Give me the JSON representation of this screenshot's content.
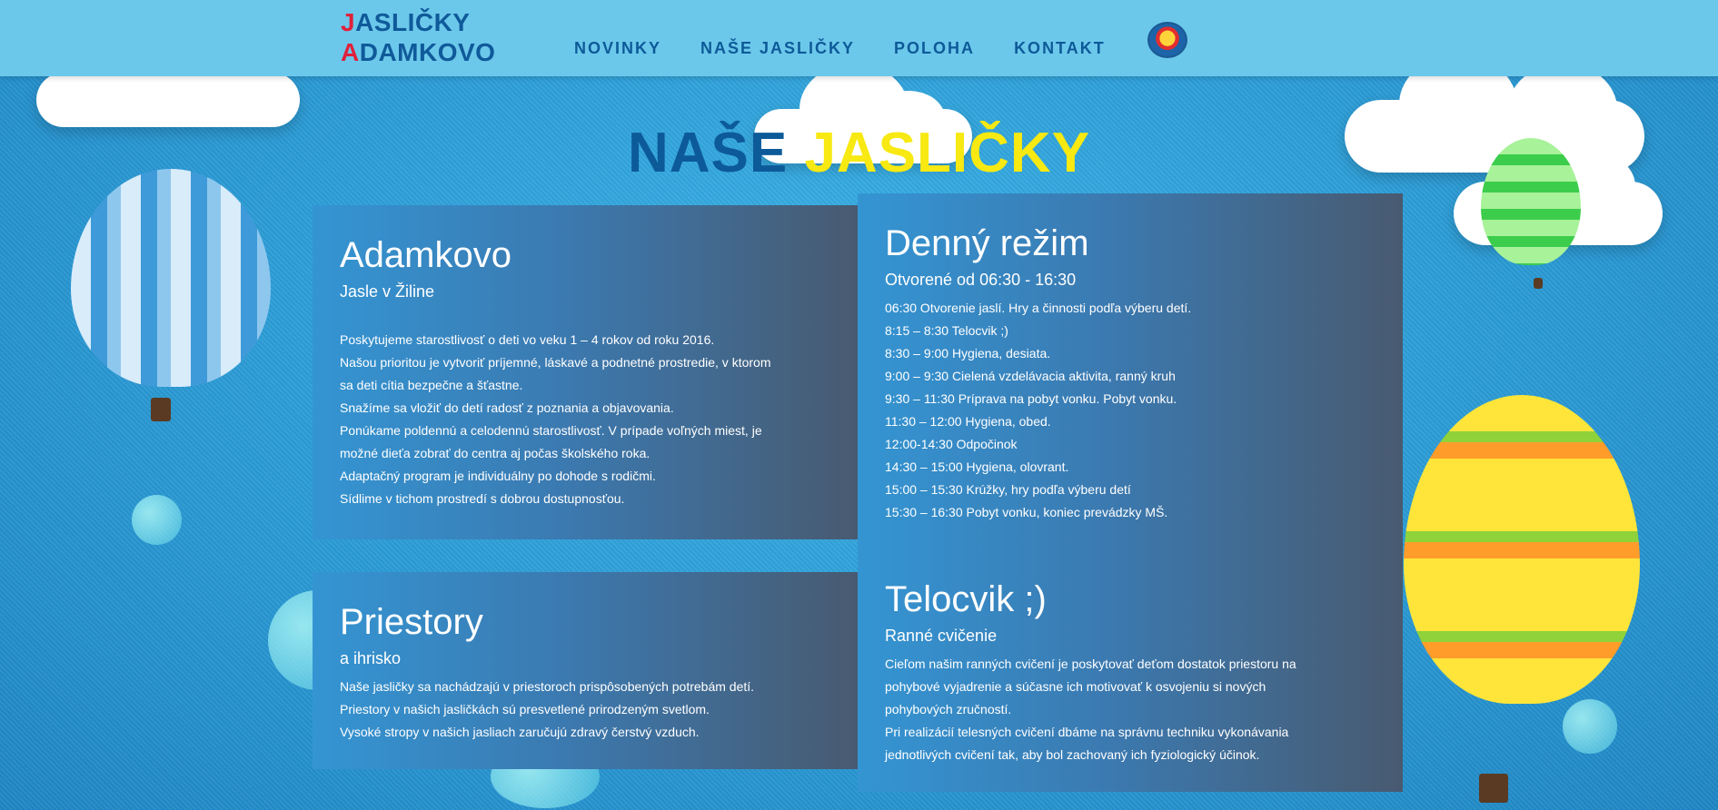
{
  "header": {
    "logo": {
      "line1_initial": "J",
      "line1_rest": "ASLIČKY",
      "line2_initial": "A",
      "line2_rest": "DAMKOVO"
    },
    "nav": [
      "NOVINKY",
      "NAŠE JASLIČKY",
      "POLOHA",
      "KONTAKT"
    ]
  },
  "title": {
    "main": "NAŠE",
    "accent": "JASLIČKY"
  },
  "panels": {
    "adamkovo": {
      "heading": "Adamkovo",
      "subheading": "Jasle v Žiline",
      "lines": [
        "Poskytujeme starostlivosť o deti vo veku 1 – 4 rokov od roku 2016.",
        "Našou prioritou je vytvoriť príjemné, láskavé a podnetné prostredie, v ktorom",
        "sa deti cítia bezpečne a šťastne.",
        "Snažíme sa vložiť do detí radosť z poznania a objavovania.",
        "Ponúkame poldennú a celodennú starostlivosť. V prípade voľných miest, je",
        "možné dieťa zobrať do centra aj počas školského roka.",
        "Adaptačný program je individuálny po dohode s rodičmi.",
        "Sídlime v tichom prostredí s dobrou dostupnosťou."
      ]
    },
    "denny_rezim": {
      "heading": "Denný režim",
      "subheading": "Otvorené od 06:30 - 16:30",
      "lines": [
        "06:30 Otvorenie jaslí. Hry a činnosti podľa výberu detí.",
        "8:15 – 8:30 Telocvik ;)",
        "8:30 – 9:00 Hygiena, desiata.",
        "9:00 – 9:30 Cielená vzdelávacia aktivita, ranný kruh",
        "9:30 – 11:30 Príprava na pobyt vonku. Pobyt vonku.",
        "11:30 – 12:00 Hygiena, obed.",
        "12:00-14:30 Odpočinok",
        "14:30 – 15:00 Hygiena, olovrant.",
        "15:00 – 15:30 Krúžky, hry podľa výberu detí",
        "15:30 – 16:30 Pobyt vonku, koniec prevádzky MŠ."
      ]
    },
    "priestory": {
      "heading": "Priestory",
      "subheading": "a ihrisko",
      "lines": [
        "Naše jasličky sa nachádzajú v priestoroch prispôsobených potrebám detí.",
        "Priestory v našich jasličkách sú presvetlené prirodzeným svetlom.",
        "Vysoké stropy v našich jasliach zaručujú zdravý čerstvý vzduch."
      ]
    },
    "telocvik": {
      "heading": "Telocvik ;)",
      "subheading": "Ranné cvičenie",
      "lines": [
        "Cieľom našim ranných cvičení je poskytovať deťom dostatok priestoru na",
        "pohybové vyjadrenie a súčasne ich motivovať k osvojeniu si nových",
        "pohybových zručností.",
        "Pri realizácií telesných cvičení dbáme na správnu techniku vykonávania",
        "jednotlivých cvičení tak, aby bol zachovaný ich fyziologický účinok."
      ]
    }
  },
  "colors": {
    "header_bg": "#6cc8ea",
    "brand_blue": "#0d5a99",
    "accent_yellow": "#f7e911",
    "accent_red": "#e0213b"
  }
}
